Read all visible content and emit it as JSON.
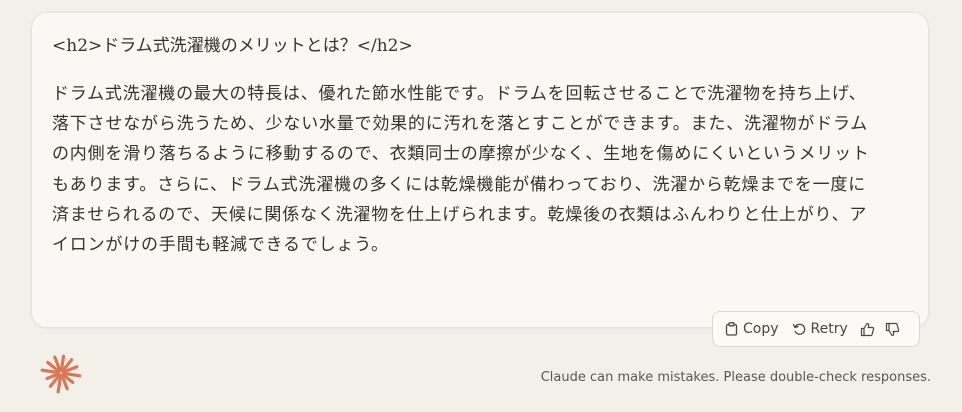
{
  "message": {
    "heading": "<h2>ドラム式洗濯機のメリットとは？</h2>",
    "body": "ドラム式洗濯機の最大の特長は、優れた節水性能です。ドラムを回転させることで洗濯物を持ち上げ、落下させながら洗うため、少ない水量で効果的に汚れを落とすことができます。また、洗濯物がドラムの内側を滑り落ちるように移動するので、衣類同士の摩擦が少なく、生地を傷めにくいというメリットもあります。さらに、ドラム式洗濯機の多くには乾燥機能が備わっており、洗濯から乾燥までを一度に済ませられるので、天候に関係なく洗濯物を仕上げられます。乾燥後の衣類はふんわりと仕上がり、アイロンがけの手間も軽減できるでしょう。"
  },
  "actions": {
    "copy_label": "Copy",
    "retry_label": "Retry",
    "copy_icon": "clipboard-icon",
    "retry_icon": "retry-arrow-icon",
    "thumbs_up_icon": "thumbs-up-icon",
    "thumbs_down_icon": "thumbs-down-icon"
  },
  "footer": {
    "disclaimer": "Claude can make mistakes. Please double-check responses.",
    "logo_icon": "claude-starburst-icon",
    "logo_color": "#d97757"
  }
}
